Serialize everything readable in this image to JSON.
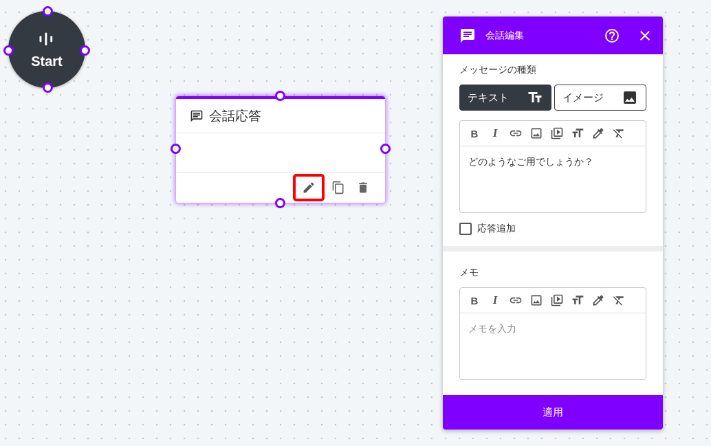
{
  "start_node": {
    "label": "Start"
  },
  "dialog_node": {
    "title": "会話応答",
    "selected": true,
    "actions": [
      {
        "kind": "edit",
        "highlighted": true
      },
      {
        "kind": "copy",
        "highlighted": false
      },
      {
        "kind": "delete",
        "highlighted": false
      }
    ]
  },
  "panel": {
    "title": "会話編集",
    "message_type": {
      "label": "メッセージの種類",
      "options": [
        {
          "kind": "text",
          "label": "テキスト",
          "selected": true
        },
        {
          "kind": "image",
          "label": "イメージ",
          "selected": false
        }
      ]
    },
    "message_editor": {
      "toolbar": [
        {
          "kind": "bold",
          "label": "B"
        },
        {
          "kind": "italic",
          "label": "I"
        },
        {
          "kind": "link"
        },
        {
          "kind": "image"
        },
        {
          "kind": "video"
        },
        {
          "kind": "size"
        },
        {
          "kind": "color"
        },
        {
          "kind": "clear"
        }
      ],
      "value": "どのようなご用でしょうか？"
    },
    "add_response": {
      "label": "応答追加",
      "checked": false
    },
    "memo": {
      "label": "メモ",
      "toolbar": [
        {
          "kind": "bold",
          "label": "B"
        },
        {
          "kind": "italic",
          "label": "I"
        },
        {
          "kind": "link"
        },
        {
          "kind": "image"
        },
        {
          "kind": "video"
        },
        {
          "kind": "size"
        },
        {
          "kind": "color"
        },
        {
          "kind": "clear"
        }
      ],
      "placeholder": "メモを入力"
    },
    "apply_button": "適用"
  }
}
